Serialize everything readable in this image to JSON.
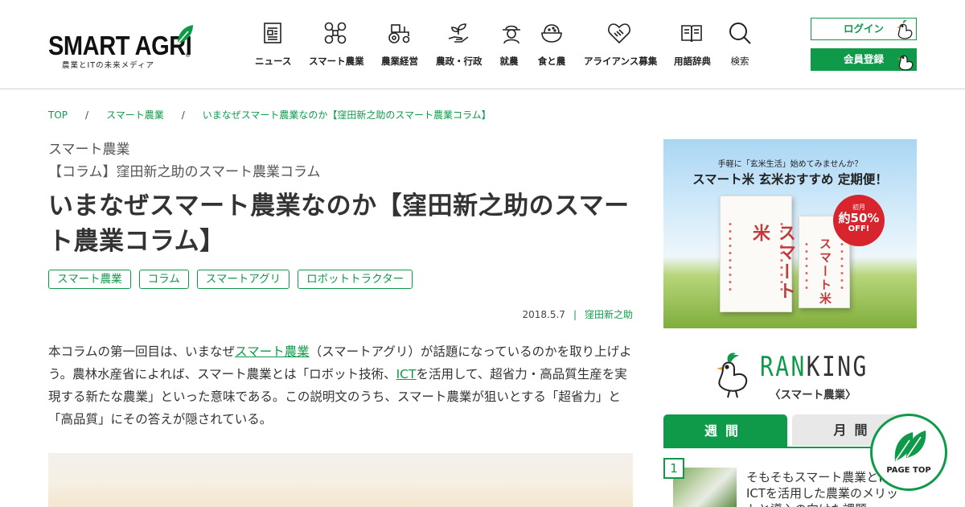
{
  "header": {
    "logo": {
      "name": "SMART AGRI",
      "tagline": "農業とITの未来メディア",
      "registered": "®"
    },
    "nav": [
      {
        "label": "ニュース",
        "icon": "newspaper-icon"
      },
      {
        "label": "スマート農業",
        "icon": "drone-icon"
      },
      {
        "label": "農業経営",
        "icon": "tractor-icon"
      },
      {
        "label": "農政・行政",
        "icon": "sprout-hand-icon"
      },
      {
        "label": "就農",
        "icon": "farmer-icon"
      },
      {
        "label": "食と農",
        "icon": "rice-bowl-icon"
      },
      {
        "label": "アライアンス募集",
        "icon": "handshake-heart-icon"
      },
      {
        "label": "用語辞典",
        "icon": "book-icon"
      },
      {
        "label": "検索",
        "icon": "search-icon"
      }
    ],
    "login_label": "ログイン",
    "register_label": "会員登録"
  },
  "breadcrumb": {
    "items": [
      "TOP",
      "スマート農業",
      "いまなぜスマート農業なのか【窪田新之助のスマート農業コラム】"
    ],
    "separator": "/"
  },
  "article": {
    "category": "スマート農業",
    "series": "【コラム】窪田新之助のスマート農業コラム",
    "title": "いまなぜスマート農業なのか【窪田新之助のスマート農業コラム】",
    "tags": [
      "スマート農業",
      "コラム",
      "スマートアグリ",
      "ロボットトラクター"
    ],
    "date": "2018.5.7",
    "meta_separator": "|",
    "author": "窪田新之助",
    "body": {
      "p1": "本コラムの第一回目は、いまなぜ",
      "link1": "スマート農業",
      "p2": "（スマートアグリ）が話題になっているのかを取り上げよう。農林水産省によれば、スマート農業とは「ロボット技術、",
      "link2": "ICT",
      "p3": "を活用して、超省力・高品質生産を実現する新たな農業」といった意味である。この説明文のうち、スマート農業が狙いとする「超省力」と「高品質」にその答えが隠されている。"
    }
  },
  "sidebar": {
    "ad": {
      "line1": "手軽に「玄米生活」始めてみませんか？",
      "line2": "スマート米 玄米おすすめ 定期便！",
      "bag_text": "スマート米",
      "badge_top": "初月",
      "badge_mid": "約50%",
      "badge_bot": "OFF!"
    },
    "ranking": {
      "title_green": "RAN",
      "title_dark": "KING",
      "subtitle": "〈スマート農業〉",
      "tab_week": "週間",
      "tab_month": "月間",
      "items": [
        {
          "rank": "1",
          "title": "そもそもスマート農業とは？ ICTを活用した農業のメリットと導入の向けた課題"
        }
      ]
    },
    "page_top": "PAGE TOP"
  },
  "colors": {
    "brand_green": "#0f9a4a",
    "text": "#333333",
    "badge_red": "#d8242d"
  }
}
